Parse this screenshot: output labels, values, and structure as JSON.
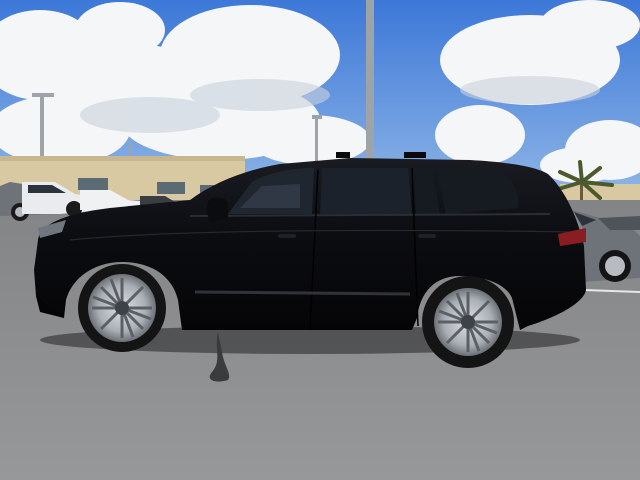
{
  "scene": {
    "description_tag": "photo",
    "colors": {
      "sky_top": "#3d78d8",
      "sky_bottom": "#8fb6e6",
      "cloud": "#f4f6f8",
      "cloud_shade": "#c9d2dc",
      "building": "#d9c9a3",
      "building_shade": "#b9a680",
      "asphalt": "#8c8d8f",
      "asphalt_dark": "#6f7072",
      "car_body": "#0d0e12",
      "car_highlight": "#2a2d35",
      "window": "#1c222b",
      "rim": "#b8bcc2",
      "tire": "#141414",
      "tail_light": "#8a1d22",
      "gray_car": "#6e7279",
      "white_truck": "#e9ebee",
      "palm": "#4b5a2e",
      "pole": "#9ea3a8"
    },
    "vehicle": {
      "color": "black",
      "type": "suv"
    }
  }
}
